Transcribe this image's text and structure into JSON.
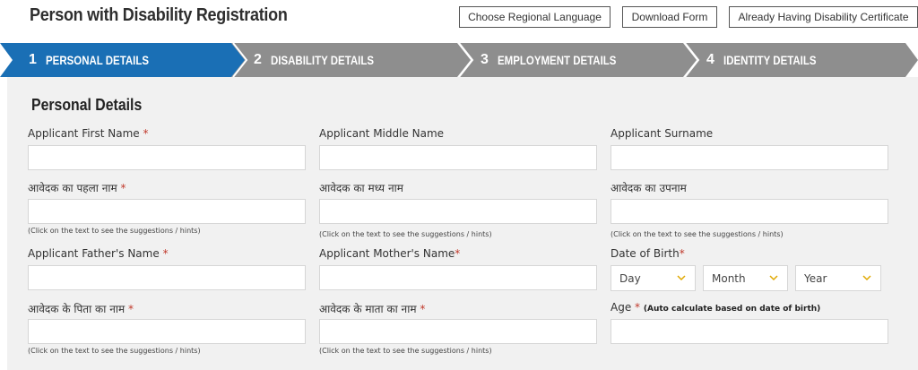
{
  "header": {
    "title": "Person with Disability Registration",
    "buttons": {
      "language": "Choose Regional Language",
      "download": "Download Form",
      "certificate": "Already Having Disability Certificate"
    }
  },
  "steps": [
    {
      "num": "1",
      "label": "PERSONAL DETAILS",
      "active": true
    },
    {
      "num": "2",
      "label": "DISABILITY DETAILS",
      "active": false
    },
    {
      "num": "3",
      "label": "EMPLOYMENT DETAILS",
      "active": false
    },
    {
      "num": "4",
      "label": "IDENTITY DETAILS",
      "active": false
    }
  ],
  "colors": {
    "active_step": "#1a6fb5",
    "inactive_step": "#8e8e8e",
    "required": "#c0392b",
    "panel_bg": "#f1f1f1"
  },
  "section": {
    "title": "Personal Details"
  },
  "form": {
    "first_name_label": "Applicant First Name",
    "middle_name_label": "Applicant Middle Name",
    "surname_label": "Applicant Surname",
    "first_name_hi_label": "आवेदक का पहला नाम",
    "middle_name_hi_label": "आवेदक का मध्य नाम",
    "surname_hi_label": "आवेदक का उपनाम",
    "hint": "(Click on the text to see the suggestions / hints)",
    "father_label": "Applicant Father's Name",
    "mother_label": "Applicant Mother's Name",
    "dob_label": "Date of Birth",
    "dob_day": "Day",
    "dob_month": "Month",
    "dob_year": "Year",
    "father_hi_label": "आवेदक के पिता का नाम",
    "mother_hi_label": "आवेदक के माता का नाम",
    "age_label": "Age",
    "age_note": "(Auto calculate based on date of birth)",
    "required_mark": "*"
  }
}
